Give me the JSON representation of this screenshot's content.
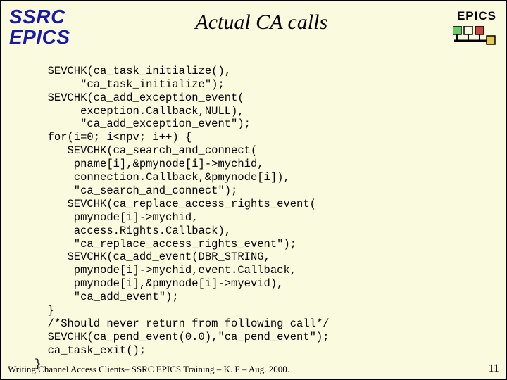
{
  "header": {
    "left_logo_line1": "SSRC",
    "left_logo_line2": "EPICS",
    "title": "Actual CA calls",
    "right_label": "EPICS"
  },
  "code": "  SEVCHK(ca_task_initialize(),\n       \"ca_task_initialize\");\n  SEVCHK(ca_add_exception_event(\n       exception.Callback,NULL),\n       \"ca_add_exception_event\");\n  for(i=0; i<npv; i++) {\n     SEVCHK(ca_search_and_connect(\n      pname[i],&pmynode[i]->mychid,\n      connection.Callback,&pmynode[i]),\n      \"ca_search_and_connect\");\n     SEVCHK(ca_replace_access_rights_event(\n      pmynode[i]->mychid,\n      access.Rights.Callback),\n      \"ca_replace_access_rights_event\");\n     SEVCHK(ca_add_event(DBR_STRING,\n      pmynode[i]->mychid,event.Callback,\n      pmynode[i],&pmynode[i]->myevid),\n      \"ca_add_event\");\n  }\n  /*Should never return from following call*/\n  SEVCHK(ca_pend_event(0.0),\"ca_pend_event\");\n  ca_task_exit();\n}",
  "footer": {
    "text": "Writing Channel Access Clients– SSRC EPICS Training – K. F – Aug. 2000.",
    "page": "11"
  }
}
